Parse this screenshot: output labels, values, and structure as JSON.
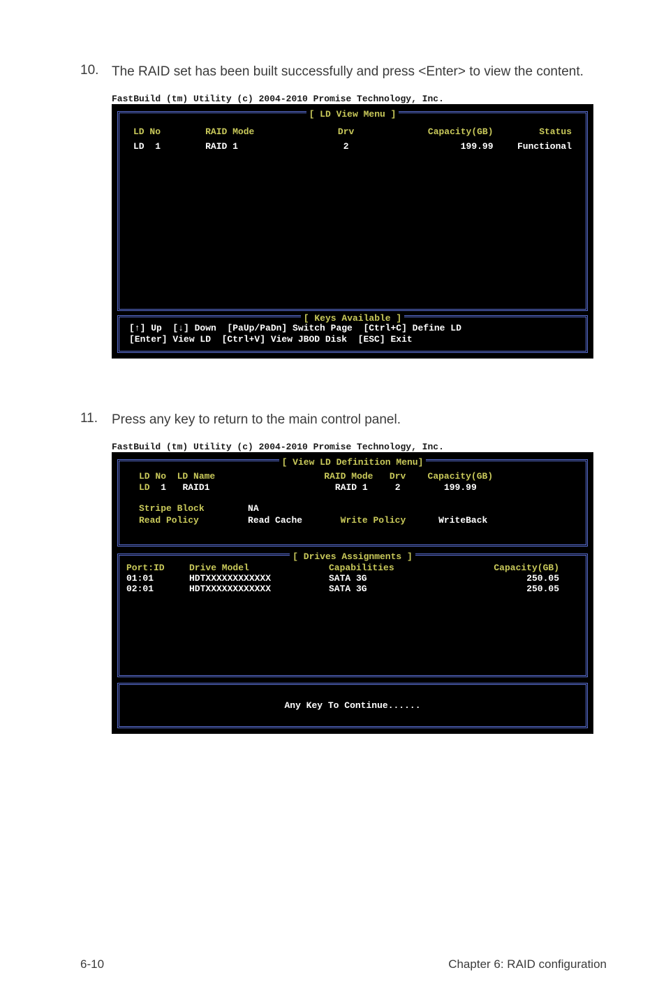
{
  "steps": {
    "a_num": "10.",
    "a_text": "The RAID set has been built successfully and press <Enter> to view the content.",
    "b_num": "11.",
    "b_text": "Press any key to return to the main control panel."
  },
  "shot1": {
    "header": "FastBuild (tm) Utility (c) 2004-2010 Promise Technology, Inc.",
    "box_title": "[ LD View Menu ]",
    "cols": {
      "ld_no": "LD No",
      "raid_mode": "RAID Mode",
      "drv": "Drv",
      "capacity": "Capacity(GB)",
      "status": "Status"
    },
    "rows": [
      {
        "ld_no": "LD  1",
        "raid_mode": "RAID 1",
        "drv": "2",
        "capacity": "199.99",
        "status": "Functional"
      }
    ],
    "keys_title": "[ Keys Available ]",
    "keys_l1": "[↑] Up  [↓] Down  [PaUp/PaDn] Switch Page  [Ctrl+C] Define LD",
    "keys_l2": "[Enter] View LD  [Ctrl+V] View JBOD Disk  [ESC] Exit"
  },
  "shot2": {
    "header": "FastBuild (tm) Utility (c) 2004-2010 Promise Technology, Inc.",
    "box_title": "[ View LD Definition Menu]",
    "def": {
      "ld_no_label": "LD No",
      "ld_name_label": "LD Name",
      "raid_mode_label": "RAID Mode",
      "drv_label": "Drv",
      "capacity_label": "Capacity(GB)",
      "ld_label": "LD",
      "ld_val": "1",
      "raid1_val": "RAID1",
      "raid_mode_val": "RAID 1",
      "drv_val": "2",
      "capacity_val": "199.99",
      "stripe_label": "Stripe Block",
      "stripe_val": "NA",
      "read_policy_label": "Read Policy",
      "read_policy_val": "Read Cache",
      "write_policy_label": "Write Policy",
      "write_policy_val": "WriteBack"
    },
    "drives_title": "[ Drives Assignments ]",
    "drives_cols": {
      "port": "Port:ID",
      "model": "Drive Model",
      "cap": "Capabilities",
      "cgb": "Capacity(GB)"
    },
    "drives_rows": [
      {
        "port": "01:01",
        "model": "HDTXXXXXXXXXXXX",
        "cap": "SATA 3G",
        "cgb": "250.05"
      },
      {
        "port": "02:01",
        "model": "HDTXXXXXXXXXXXX",
        "cap": "SATA 3G",
        "cgb": "250.05"
      }
    ],
    "anykey": "Any Key To Continue......"
  },
  "footer": {
    "left": "6-10",
    "right": "Chapter 6: RAID configuration"
  }
}
